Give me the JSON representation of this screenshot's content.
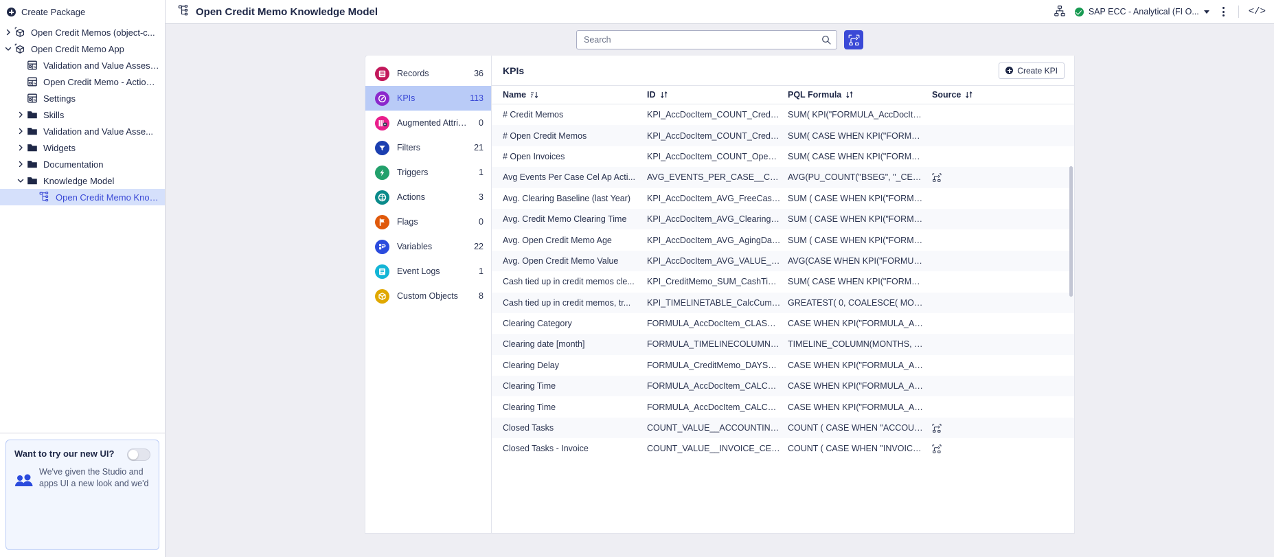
{
  "sidebar": {
    "create_package": "Create Package",
    "tree": [
      {
        "label": "Open Credit Memos (object-c...",
        "icon": "package-icon",
        "indent": 0,
        "chevron": "right",
        "selected": false
      },
      {
        "label": "Open Credit Memo App",
        "icon": "package-icon",
        "indent": 0,
        "chevron": "down",
        "selected": false
      },
      {
        "label": "Validation and Value Assessment",
        "icon": "view-icon",
        "indent": 1,
        "chevron": "none",
        "selected": false
      },
      {
        "label": "Open Credit Memo - Action View",
        "icon": "view-icon",
        "indent": 1,
        "chevron": "none",
        "selected": false
      },
      {
        "label": "Settings",
        "icon": "view-icon",
        "indent": 1,
        "chevron": "none",
        "selected": false
      },
      {
        "label": "Skills",
        "icon": "folder-icon",
        "indent": 1,
        "chevron": "right",
        "selected": false
      },
      {
        "label": "Validation and Value Asse...",
        "icon": "folder-icon",
        "indent": 1,
        "chevron": "right",
        "selected": false
      },
      {
        "label": "Widgets",
        "icon": "folder-icon",
        "indent": 1,
        "chevron": "right",
        "selected": false
      },
      {
        "label": "Documentation",
        "icon": "folder-icon",
        "indent": 1,
        "chevron": "right",
        "selected": false
      },
      {
        "label": "Knowledge Model",
        "icon": "folder-icon",
        "indent": 1,
        "chevron": "down",
        "selected": false
      },
      {
        "label": "Open Credit Memo Knowled...",
        "icon": "knowledge-model-icon",
        "indent": 2,
        "chevron": "none",
        "selected": true
      }
    ],
    "promo": {
      "title": "Want to try our new UI?",
      "body": "We've given the Studio and apps UI a new look and we'd",
      "toggle_on": false
    }
  },
  "topbar": {
    "title": "Open Credit Memo Knowledge Model",
    "datapool": "SAP ECC - Analytical (FI O...",
    "icons": [
      "lineage-icon",
      "kebab-menu-icon",
      "code-view-icon"
    ]
  },
  "search": {
    "placeholder": "Search",
    "value": "",
    "graph_button": "graph-view-button"
  },
  "categories": [
    {
      "label": "Records",
      "count": "36",
      "color": "#c2185b",
      "icon": "records-icon",
      "active": false
    },
    {
      "label": "KPIs",
      "count": "113",
      "color": "#8b28cc",
      "icon": "kpi-icon",
      "active": true
    },
    {
      "label": "Augmented Attributes",
      "count": "0",
      "color": "#e91e8c",
      "icon": "augmented-attributes-icon",
      "active": false
    },
    {
      "label": "Filters",
      "count": "21",
      "color": "#1b3fb0",
      "icon": "filters-icon",
      "active": false
    },
    {
      "label": "Triggers",
      "count": "1",
      "color": "#22a06b",
      "icon": "triggers-icon",
      "active": false
    },
    {
      "label": "Actions",
      "count": "3",
      "color": "#0a8a8a",
      "icon": "actions-icon",
      "active": false
    },
    {
      "label": "Flags",
      "count": "0",
      "color": "#e0590b",
      "icon": "flags-icon",
      "active": false
    },
    {
      "label": "Variables",
      "count": "22",
      "color": "#2b4bdd",
      "icon": "variables-icon",
      "active": false
    },
    {
      "label": "Event Logs",
      "count": "1",
      "color": "#13b5d6",
      "icon": "event-logs-icon",
      "active": false
    },
    {
      "label": "Custom Objects",
      "count": "8",
      "color": "#e0a800",
      "icon": "custom-objects-icon",
      "active": false
    }
  ],
  "table": {
    "title": "KPIs",
    "create_button": "Create KPI",
    "columns": [
      {
        "label": "Name",
        "sort": "desc"
      },
      {
        "label": "ID",
        "sort": "none"
      },
      {
        "label": "PQL Formula",
        "sort": "none"
      },
      {
        "label": "Source",
        "sort": "none"
      }
    ],
    "rows": [
      {
        "name": "# Credit Memos",
        "id": "KPI_AccDocItem_COUNT_CreditMe...",
        "pql": "SUM( KPI(\"FORMULA_AccDocItem_I...",
        "source": ""
      },
      {
        "name": "# Open Credit Memos",
        "id": "KPI_AccDocItem_COUNT_CreditMemo",
        "pql": "SUM( CASE WHEN KPI(\"FORMULA_...",
        "source": ""
      },
      {
        "name": "# Open Invoices",
        "id": "KPI_AccDocItem_COUNT_OpenInvoi...",
        "pql": "SUM( CASE WHEN KPI(\"FORMULA_...",
        "source": ""
      },
      {
        "name": "Avg Events Per Case Cel Ap Acti...",
        "id": "AVG_EVENTS_PER_CASE__CEL_AP_...",
        "pql": "AVG(PU_COUNT(\"BSEG\", \"_CEL_AP_...",
        "source": "source-icon"
      },
      {
        "name": "Avg. Clearing Baseline (last Year)",
        "id": "KPI_AccDocItem_AVG_FreeCashFlo...",
        "pql": "SUM ( CASE WHEN KPI(\"FORMULA_...",
        "source": ""
      },
      {
        "name": "Avg. Credit Memo Clearing Time",
        "id": "KPI_AccDocItem_AVG_ClearingTime...",
        "pql": "SUM ( CASE WHEN KPI(\"FORMULA_...",
        "source": ""
      },
      {
        "name": "Avg. Open Credit Memo Age",
        "id": "KPI_AccDocItem_AVG_AgingDays_Cr...",
        "pql": "SUM ( CASE WHEN KPI(\"FORMULA_...",
        "source": ""
      },
      {
        "name": "Avg. Open Credit Memo Value",
        "id": "KPI_AccDocItem_AVG_VALUE_Credit...",
        "pql": "AVG(CASE WHEN KPI(\"FORMULA_A...",
        "source": ""
      },
      {
        "name": "Cash tied up in credit memos cle...",
        "id": "KPI_CreditMemo_SUM_CashTiedInO...",
        "pql": "SUM( CASE WHEN KPI(\"FORMULA_...",
        "source": ""
      },
      {
        "name": "Cash tied up in credit memos, tr...",
        "id": "KPI_TIMELINETABLE_CalcCumulativ...",
        "pql": "GREATEST( 0, COALESCE( MOVING_...",
        "source": ""
      },
      {
        "name": "Clearing Category",
        "id": "FORMULA_AccDocItem_CLASSIFICA...",
        "pql": "CASE WHEN KPI(\"FORMULA_AccDo...",
        "source": ""
      },
      {
        "name": "Clearing date [month]",
        "id": "FORMULA_TIMELINECOLUMN_Clear...",
        "pql": "TIMELINE_COLUMN(MONTHS, \"BSE...",
        "source": ""
      },
      {
        "name": "Clearing Delay",
        "id": "FORMULA_CreditMemo_DAYS_Clear...",
        "pql": "CASE WHEN KPI(\"FORMULA_AccDo...",
        "source": ""
      },
      {
        "name": "Clearing Time",
        "id": "FORMULA_AccDocItem_CALC_Invoi...",
        "pql": "CASE WHEN KPI(\"FORMULA_AccDo...",
        "source": ""
      },
      {
        "name": "Clearing Time",
        "id": "FORMULA_AccDocItem_CALC_Invoi...",
        "pql": "CASE WHEN KPI(\"FORMULA_AccDo...",
        "source": ""
      },
      {
        "name": "Closed Tasks",
        "id": "COUNT_VALUE__ACCOUNTING_DO...",
        "pql": "COUNT ( CASE WHEN \"ACCOUNTIN...",
        "source": "source-icon"
      },
      {
        "name": "Closed Tasks - Invoice",
        "id": "COUNT_VALUE__INVOICE_CEL_TASK...",
        "pql": "COUNT ( CASE WHEN \"INVOICE_CE...",
        "source": "source-icon"
      }
    ]
  }
}
